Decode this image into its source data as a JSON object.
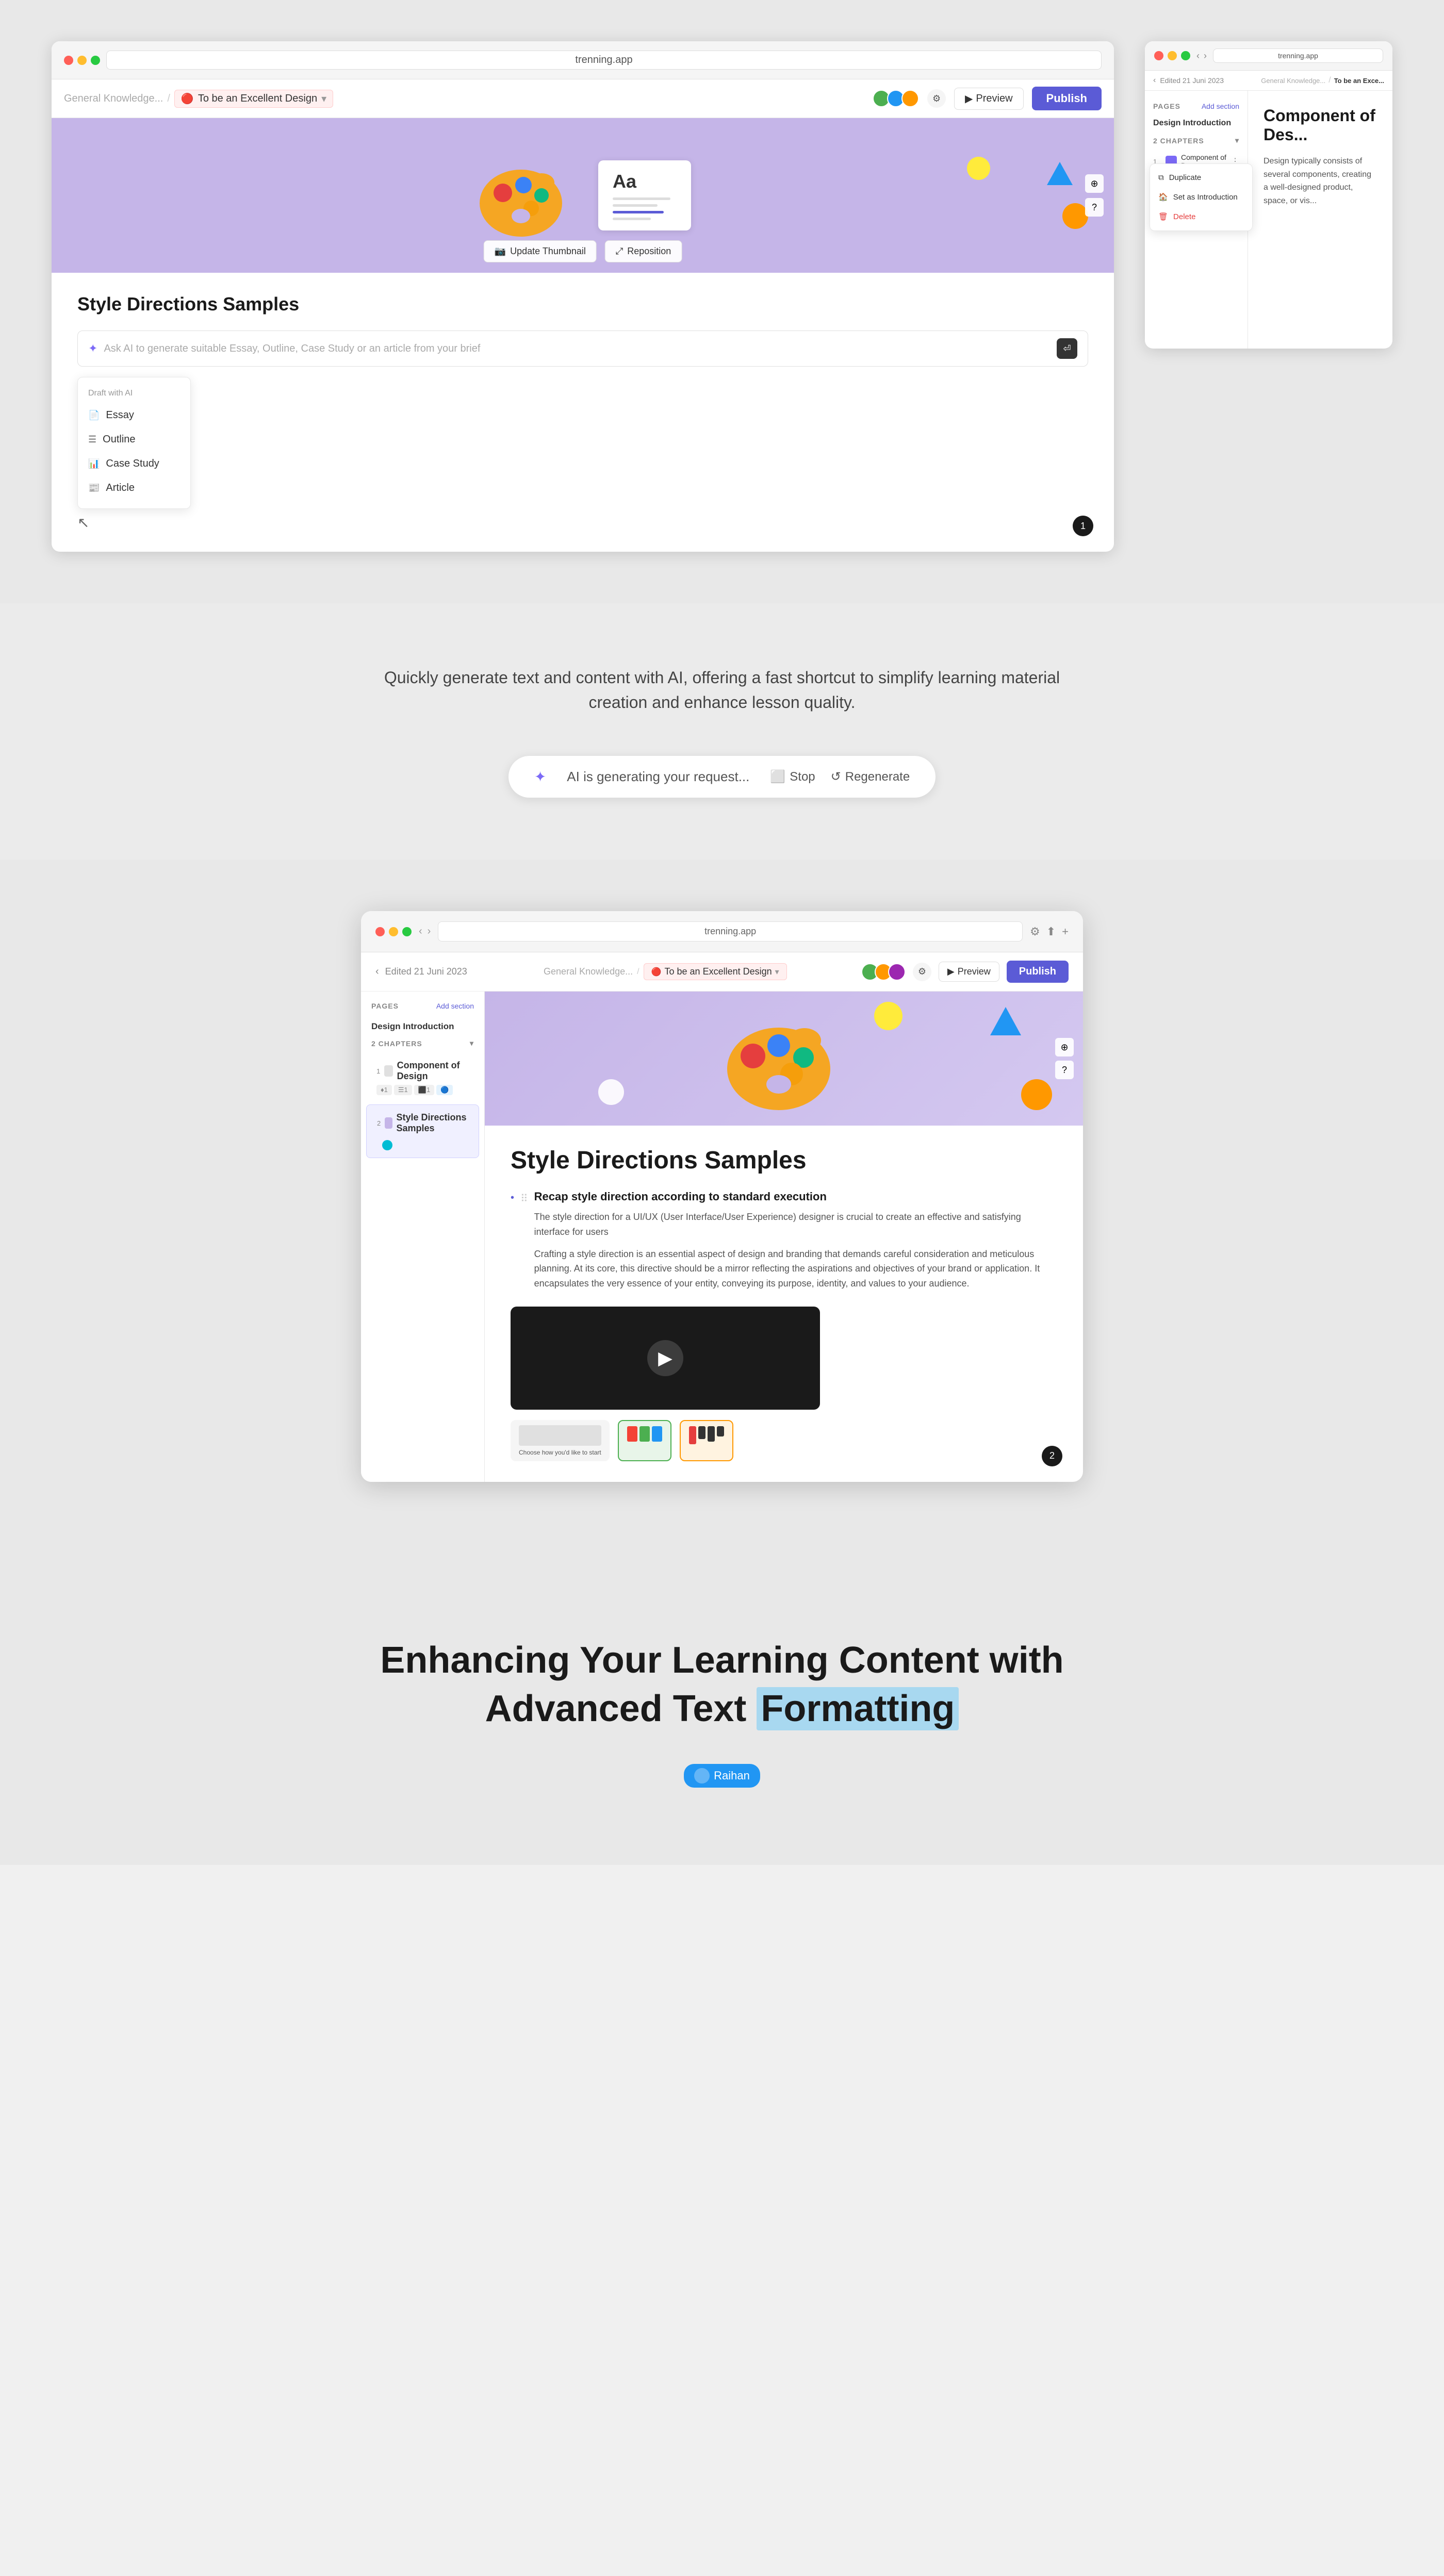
{
  "page": {
    "title": "To be an Excellent Design"
  },
  "section1": {
    "left_browser": {
      "address": "trenning.app",
      "breadcrumb": [
        "General Knowledge...",
        "To be an Excellent Design"
      ],
      "toolbar": {
        "preview_label": "Preview",
        "publish_label": "Publish"
      },
      "hero": {
        "update_thumbnail_label": "Update Thumbnail",
        "reposition_label": "Reposition"
      },
      "page_title": "Style Directions Samples",
      "ai_input_placeholder": "Ask AI to generate suitable Essay, Outline, Case Study or an article from your brief",
      "draft_label": "Draft with AI",
      "draft_items": [
        {
          "icon": "📄",
          "label": "Essay"
        },
        {
          "icon": "☰",
          "label": "Outline"
        },
        {
          "icon": "📊",
          "label": "Case Study"
        },
        {
          "icon": "📰",
          "label": "Article"
        }
      ],
      "dot_number": "1"
    },
    "right_browser": {
      "address": "trenning.app",
      "breadcrumb": [
        "General Knowledge...",
        "To be an Exce..."
      ],
      "edited_label": "Edited 21 Juni 2023",
      "pages_label": "PAGES",
      "add_section_label": "Add section",
      "design_intro_label": "Design Introduction",
      "chapters_count": "2 CHAPTERS",
      "chapters": [
        {
          "num": "1",
          "label": "Component of Des...",
          "context_menu": true
        }
      ],
      "context_menu_items": [
        {
          "icon": "⧉",
          "label": "Duplicate"
        },
        {
          "icon": "🏠",
          "label": "Set as Introduction"
        },
        {
          "icon": "🗑",
          "label": "Delete",
          "danger": true
        }
      ],
      "main_title": "Component of Des...",
      "main_body": "Design typically consists of several components, creating a well-designed product, space, or vis..."
    }
  },
  "section2": {
    "description": "Quickly generate text and content with AI, offering a fast shortcut to simplify\nlearning material creation and enhance lesson quality.",
    "ai_generating": {
      "icon": "✦",
      "text": "AI is generating your request...",
      "stop_label": "Stop",
      "regenerate_label": "Regenerate"
    }
  },
  "section3": {
    "browser": {
      "address": "trenning.app",
      "edited_label": "Edited 21 Juni 2023",
      "breadcrumb": [
        "General Knowledge...",
        "To be an Excellent Design"
      ],
      "preview_label": "Preview",
      "publish_label": "Publish",
      "pages_label": "PAGES",
      "add_section_label": "Add section",
      "design_intro_label": "Design Introduction",
      "chapters_label": "2 CHAPTERS",
      "chapters": [
        {
          "num": "1",
          "label": "Component of Design",
          "active": false,
          "meta": [
            "♦1",
            "☰1",
            "⬛1",
            "🔵"
          ]
        },
        {
          "num": "2",
          "label": "Style Directions Samples",
          "active": true,
          "sub": [
            {
              "icon": "🔵",
              "label": ""
            }
          ]
        }
      ],
      "page_title": "Style Directions Samples",
      "content_blocks": [
        {
          "title": "Recap style direction according to standard execution",
          "body_1": "The style direction for a UI/UX (User Interface/User Experience) designer is crucial to create an effective and satisfying interface for users",
          "body_2": "Crafting a style direction is an essential aspect of design and branding that demands careful consideration and meticulous planning. At its core, this directive should be a mirror reflecting the aspirations and objectives of your brand or application. It encapsulates the very essence of your entity, conveying its purpose, identity, and values to your audience."
        }
      ],
      "dot_number": "2"
    }
  },
  "section4": {
    "heading_line1": "Enhancing Your Learning Content with",
    "heading_line2": "Advanced Text",
    "heading_highlight": "Formatting",
    "author": {
      "name": "Raihan",
      "avatar_color": "#2196F3"
    }
  }
}
